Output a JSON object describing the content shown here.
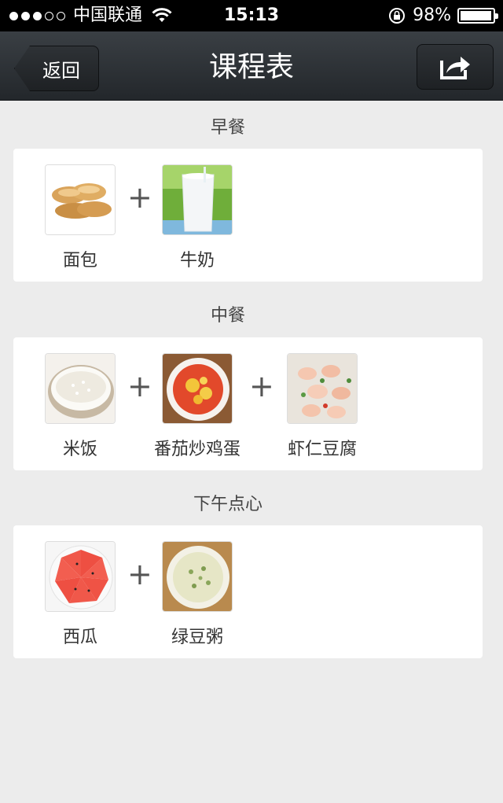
{
  "status_bar": {
    "carrier": "中国联通",
    "time": "15:13",
    "battery": "98%",
    "battery_level": 0.98
  },
  "navbar": {
    "back_label": "返回",
    "title": "课程表",
    "share_icon": "share-icon"
  },
  "meals": [
    {
      "title": "早餐",
      "items": [
        {
          "name": "面包",
          "icon": "bread-icon"
        },
        {
          "name": "牛奶",
          "icon": "milk-icon"
        }
      ]
    },
    {
      "title": "中餐",
      "items": [
        {
          "name": "米饭",
          "icon": "rice-icon"
        },
        {
          "name": "番茄炒鸡蛋",
          "icon": "tomato-egg-icon"
        },
        {
          "name": "虾仁豆腐",
          "icon": "shrimp-tofu-icon"
        }
      ]
    },
    {
      "title": "下午点心",
      "items": [
        {
          "name": "西瓜",
          "icon": "watermelon-icon"
        },
        {
          "name": "绿豆粥",
          "icon": "mungbean-porridge-icon"
        }
      ]
    }
  ]
}
